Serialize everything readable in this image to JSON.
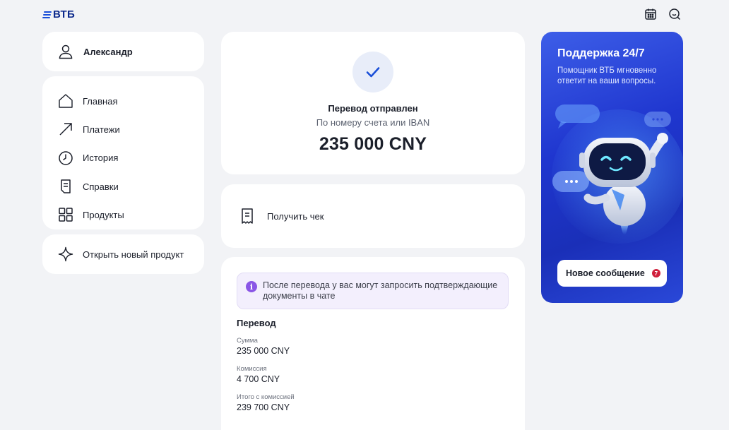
{
  "brand": {
    "name": "ВТБ"
  },
  "header": {
    "icons": [
      "calendar-icon",
      "search-chat-icon"
    ]
  },
  "user": {
    "name": "Александр"
  },
  "nav": {
    "items": [
      {
        "label": "Главная",
        "icon": "home-icon"
      },
      {
        "label": "Платежи",
        "icon": "arrow-up-right-icon"
      },
      {
        "label": "История",
        "icon": "clock-icon"
      },
      {
        "label": "Справки",
        "icon": "document-icon"
      },
      {
        "label": "Продукты",
        "icon": "grid-icon"
      }
    ],
    "open_product": "Открыть новый продукт"
  },
  "status": {
    "title": "Перевод отправлен",
    "subtitle": "По номеру счета или IBAN",
    "amount": "235 000 CNY"
  },
  "receipt": {
    "label": "Получить чек"
  },
  "details": {
    "notice": "После перевода у вас могут запросить подтверждающие документы в чате",
    "title": "Перевод",
    "rows": [
      {
        "label": "Сумма",
        "value": "235 000 CNY"
      },
      {
        "label": "Комиссия",
        "value": "4 700 CNY"
      },
      {
        "label": "Итого с комиссией",
        "value": "239 700 CNY"
      }
    ]
  },
  "promo": {
    "title": "Поддержка 24/7",
    "text": "Помощник ВТБ мгновенно ответит на ваши вопросы.",
    "button": "Новое сообщение",
    "badge": "7"
  },
  "colors": {
    "background": "#f2f3f6",
    "brand": "#0d2a8c",
    "accent": "#1a4fd8",
    "promo": "#1f36cf",
    "badge": "#d0203c",
    "info": "#8a56e6"
  }
}
